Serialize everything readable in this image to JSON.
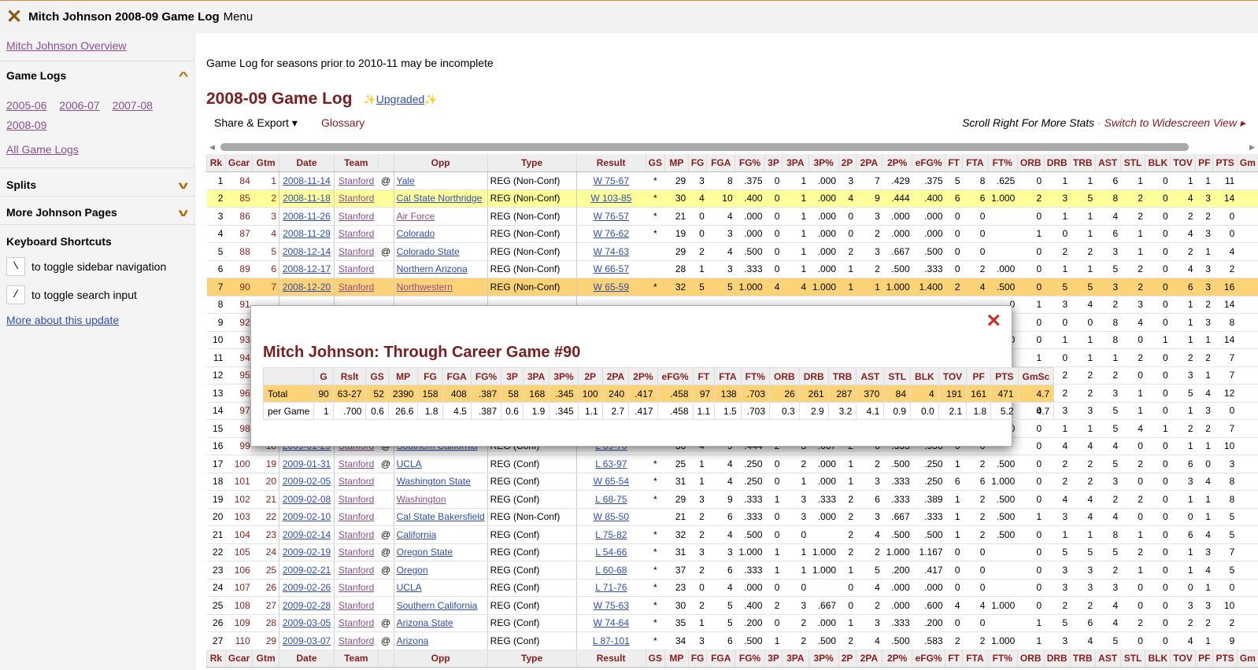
{
  "topbar": {
    "title": "Mitch Johnson 2008-09 Game Log",
    "menu": "Menu"
  },
  "sidebar": {
    "overview": "Mitch Johnson Overview",
    "game_logs_header": "Game Logs",
    "seasons": [
      "2005-06",
      "2006-07",
      "2007-08",
      "2008-09"
    ],
    "all_game_logs": "All Game Logs",
    "splits": "Splits",
    "more_pages": "More Johnson Pages",
    "keyboard_header": "Keyboard Shortcuts",
    "shortcuts": [
      {
        "key": "\\",
        "desc": "to toggle sidebar navigation"
      },
      {
        "key": "/",
        "desc": "to toggle search input"
      }
    ],
    "more_about": "More about this update"
  },
  "main": {
    "notice": "Game Log for seasons prior to 2010-11 may be incomplete",
    "heading": "2008-09 Game Log",
    "upgraded": "Upgraded",
    "share_export": "Share & Export ▾",
    "glossary": "Glossary",
    "scroll_hint": "Scroll Right For More Stats",
    "separator": "·",
    "widescreen": "Switch to Widescreen View ▸"
  },
  "table": {
    "columns": [
      "Rk",
      "Gcar",
      "Gtm",
      "Date",
      "Team",
      "",
      "Opp",
      "Type",
      "Result",
      "GS",
      "MP",
      "FG",
      "FGA",
      "FG%",
      "3P",
      "3PA",
      "3P%",
      "2P",
      "2PA",
      "2P%",
      "eFG%",
      "FT",
      "FTA",
      "FT%",
      "ORB",
      "DRB",
      "TRB",
      "AST",
      "STL",
      "BLK",
      "TOV",
      "PF",
      "PTS",
      "Gm"
    ],
    "rows": [
      [
        "1",
        "84",
        "1",
        "2008-11-14",
        "Stanford",
        "@",
        "Yale",
        "REG (Non-Conf)",
        "W 75-67",
        "*",
        "29",
        "3",
        "8",
        ".375",
        "0",
        "1",
        ".000",
        "3",
        "7",
        ".429",
        ".375",
        "5",
        "8",
        ".625",
        "0",
        "1",
        "1",
        "6",
        "1",
        "0",
        "1",
        "1",
        "11",
        ""
      ],
      [
        "2",
        "85",
        "2",
        "2008-11-18",
        "Stanford",
        "",
        "Cal State Northridge",
        "REG (Non-Conf)",
        "W 103-85",
        "*",
        "30",
        "4",
        "10",
        ".400",
        "0",
        "1",
        ".000",
        "4",
        "9",
        ".444",
        ".400",
        "6",
        "6",
        "1.000",
        "2",
        "3",
        "5",
        "8",
        "2",
        "0",
        "4",
        "3",
        "14",
        ""
      ],
      [
        "3",
        "86",
        "3",
        "2008-11-26",
        "Stanford",
        "",
        "Air Force",
        "REG (Non-Conf)",
        "W 76-57",
        "*",
        "21",
        "0",
        "4",
        ".000",
        "0",
        "1",
        ".000",
        "0",
        "3",
        ".000",
        ".000",
        "0",
        "0",
        "",
        "0",
        "1",
        "1",
        "4",
        "2",
        "0",
        "2",
        "2",
        "0",
        ""
      ],
      [
        "4",
        "87",
        "4",
        "2008-11-29",
        "Stanford",
        "",
        "Colorado",
        "REG (Non-Conf)",
        "W 76-62",
        "*",
        "19",
        "0",
        "3",
        ".000",
        "0",
        "1",
        ".000",
        "0",
        "2",
        ".000",
        ".000",
        "0",
        "0",
        "",
        "1",
        "0",
        "1",
        "6",
        "1",
        "0",
        "4",
        "3",
        "0",
        ""
      ],
      [
        "5",
        "88",
        "5",
        "2008-12-14",
        "Stanford",
        "@",
        "Colorado State",
        "REG (Non-Conf)",
        "W 74-63",
        "",
        "29",
        "2",
        "4",
        ".500",
        "0",
        "1",
        ".000",
        "2",
        "3",
        ".667",
        ".500",
        "0",
        "0",
        "",
        "0",
        "2",
        "2",
        "3",
        "1",
        "0",
        "2",
        "1",
        "4",
        ""
      ],
      [
        "6",
        "89",
        "6",
        "2008-12-17",
        "Stanford",
        "",
        "Northern Arizona",
        "REG (Non-Conf)",
        "W 66-57",
        "",
        "28",
        "1",
        "3",
        ".333",
        "0",
        "1",
        ".000",
        "1",
        "2",
        ".500",
        ".333",
        "0",
        "2",
        ".000",
        "0",
        "1",
        "1",
        "5",
        "2",
        "0",
        "4",
        "3",
        "2",
        ""
      ],
      [
        "7",
        "90",
        "7",
        "2008-12-20",
        "Stanford",
        "",
        "Northwestern",
        "REG (Non-Conf)",
        "W 65-59",
        "*",
        "32",
        "5",
        "5",
        "1.000",
        "4",
        "4",
        "1.000",
        "1",
        "1",
        "1.000",
        "1.400",
        "2",
        "4",
        ".500",
        "0",
        "5",
        "5",
        "3",
        "2",
        "0",
        "6",
        "3",
        "16",
        ""
      ],
      [
        "8",
        "91",
        "",
        "",
        "",
        "",
        "",
        "",
        "",
        "",
        "",
        "",
        "",
        "",
        "",
        "",
        "",
        "",
        "",
        "",
        "",
        "",
        "",
        "0",
        "1",
        "3",
        "4",
        "2",
        "3",
        "0",
        "1",
        "2",
        "14",
        ""
      ],
      [
        "9",
        "92",
        "",
        "",
        "",
        "",
        "",
        "",
        "",
        "",
        "",
        "",
        "",
        "",
        "",
        "",
        "",
        "",
        "",
        "",
        "",
        "",
        "",
        "",
        "0",
        "0",
        "0",
        "8",
        "4",
        "0",
        "1",
        "3",
        "8",
        ""
      ],
      [
        "10",
        "93",
        "",
        "",
        "",
        "",
        "",
        "",
        "",
        "",
        "",
        "",
        "",
        "",
        "",
        "",
        "",
        "",
        "",
        "",
        "",
        "",
        "",
        "0",
        "0",
        "1",
        "1",
        "8",
        "0",
        "1",
        "1",
        "1",
        "14",
        ""
      ],
      [
        "11",
        "94",
        "",
        "",
        "",
        "",
        "",
        "",
        "",
        "",
        "",
        "",
        "",
        "",
        "",
        "",
        "",
        "",
        "",
        "",
        "",
        "",
        "",
        "",
        "1",
        "0",
        "1",
        "1",
        "2",
        "0",
        "2",
        "2",
        "7",
        ""
      ],
      [
        "12",
        "95",
        "",
        "",
        "",
        "",
        "",
        "",
        "",
        "",
        "",
        "",
        "",
        "",
        "",
        "",
        "",
        "",
        "",
        "",
        "",
        "",
        "",
        "0",
        "0",
        "2",
        "2",
        "2",
        "0",
        "0",
        "3",
        "1",
        "7",
        ""
      ],
      [
        "13",
        "96",
        "",
        "",
        "",
        "",
        "",
        "",
        "",
        "",
        "",
        "",
        "",
        "",
        "",
        "",
        "",
        "",
        "",
        "",
        "",
        "",
        "",
        "0",
        "0",
        "2",
        "2",
        "3",
        "1",
        "0",
        "5",
        "4",
        "12",
        ""
      ],
      [
        "14",
        "97",
        "",
        "",
        "",
        "",
        "",
        "",
        "",
        "",
        "",
        "",
        "",
        "",
        "",
        "",
        "",
        "",
        "",
        "",
        "",
        "",
        "",
        "",
        "0",
        "3",
        "3",
        "5",
        "1",
        "0",
        "1",
        "3",
        "0",
        ""
      ],
      [
        "15",
        "98",
        "",
        "",
        "",
        "",
        "",
        "",
        "",
        "",
        "",
        "",
        "",
        "",
        "",
        "",
        "",
        "",
        "",
        "",
        "",
        "",
        "",
        "0",
        "0",
        "1",
        "1",
        "5",
        "4",
        "1",
        "2",
        "2",
        "7",
        ""
      ],
      [
        "16",
        "99",
        "18",
        "2009-01-29",
        "Stanford",
        "@",
        "Southern California",
        "REG (Conf)",
        "L 69-70",
        "*",
        "36",
        "4",
        "9",
        ".444",
        "2",
        "3",
        ".667",
        "2",
        "6",
        ".333",
        ".556",
        "0",
        "0",
        "",
        "0",
        "4",
        "4",
        "4",
        "0",
        "0",
        "1",
        "1",
        "10",
        ""
      ],
      [
        "17",
        "100",
        "19",
        "2009-01-31",
        "Stanford",
        "@",
        "UCLA",
        "REG (Conf)",
        "L 63-97",
        "*",
        "25",
        "1",
        "4",
        ".250",
        "0",
        "2",
        ".000",
        "1",
        "2",
        ".500",
        ".250",
        "1",
        "2",
        ".500",
        "0",
        "2",
        "2",
        "5",
        "2",
        "0",
        "6",
        "0",
        "3",
        ""
      ],
      [
        "18",
        "101",
        "20",
        "2009-02-05",
        "Stanford",
        "",
        "Washington State",
        "REG (Conf)",
        "W 65-54",
        "*",
        "31",
        "1",
        "4",
        ".250",
        "0",
        "1",
        ".000",
        "1",
        "3",
        ".333",
        ".250",
        "6",
        "6",
        "1.000",
        "0",
        "2",
        "2",
        "3",
        "0",
        "0",
        "3",
        "4",
        "8",
        ""
      ],
      [
        "19",
        "102",
        "21",
        "2009-02-08",
        "Stanford",
        "",
        "Washington",
        "REG (Conf)",
        "L 68-75",
        "*",
        "29",
        "3",
        "9",
        ".333",
        "1",
        "3",
        ".333",
        "2",
        "6",
        ".333",
        ".389",
        "1",
        "2",
        ".500",
        "0",
        "4",
        "4",
        "2",
        "2",
        "0",
        "1",
        "1",
        "8",
        ""
      ],
      [
        "20",
        "103",
        "22",
        "2009-02-10",
        "Stanford",
        "",
        "Cal State Bakersfield",
        "REG (Non-Conf)",
        "W 85-50",
        "",
        "21",
        "2",
        "6",
        ".333",
        "0",
        "3",
        ".000",
        "2",
        "3",
        ".667",
        ".333",
        "1",
        "2",
        ".500",
        "1",
        "3",
        "4",
        "4",
        "0",
        "0",
        "0",
        "1",
        "5",
        ""
      ],
      [
        "21",
        "104",
        "23",
        "2009-02-14",
        "Stanford",
        "@",
        "California",
        "REG (Conf)",
        "L 75-82",
        "*",
        "32",
        "2",
        "4",
        ".500",
        "0",
        "0",
        "",
        "2",
        "4",
        ".500",
        ".500",
        "1",
        "2",
        ".500",
        "0",
        "1",
        "1",
        "8",
        "1",
        "0",
        "6",
        "4",
        "5",
        ""
      ],
      [
        "22",
        "105",
        "24",
        "2009-02-19",
        "Stanford",
        "@",
        "Oregon State",
        "REG (Conf)",
        "L 54-66",
        "*",
        "31",
        "3",
        "3",
        "1.000",
        "1",
        "1",
        "1.000",
        "2",
        "2",
        "1.000",
        "1.167",
        "0",
        "0",
        "",
        "0",
        "5",
        "5",
        "5",
        "2",
        "0",
        "1",
        "3",
        "7",
        ""
      ],
      [
        "23",
        "106",
        "25",
        "2009-02-21",
        "Stanford",
        "@",
        "Oregon",
        "REG (Conf)",
        "L 60-68",
        "*",
        "37",
        "2",
        "6",
        ".333",
        "1",
        "1",
        "1.000",
        "1",
        "5",
        ".200",
        ".417",
        "0",
        "0",
        "",
        "0",
        "3",
        "3",
        "2",
        "1",
        "0",
        "1",
        "4",
        "5",
        ""
      ],
      [
        "24",
        "107",
        "26",
        "2009-02-26",
        "Stanford",
        "",
        "UCLA",
        "REG (Conf)",
        "L 71-76",
        "*",
        "23",
        "0",
        "4",
        ".000",
        "0",
        "0",
        "",
        "0",
        "4",
        ".000",
        ".000",
        "0",
        "0",
        "",
        "0",
        "3",
        "3",
        "3",
        "0",
        "0",
        "0",
        "1",
        "0",
        ""
      ],
      [
        "25",
        "108",
        "27",
        "2009-02-28",
        "Stanford",
        "",
        "Southern California",
        "REG (Conf)",
        "W 75-63",
        "*",
        "30",
        "2",
        "5",
        ".400",
        "2",
        "3",
        ".667",
        "0",
        "2",
        ".000",
        ".600",
        "4",
        "4",
        "1.000",
        "0",
        "2",
        "2",
        "4",
        "0",
        "0",
        "3",
        "3",
        "10",
        ""
      ],
      [
        "26",
        "109",
        "28",
        "2009-03-05",
        "Stanford",
        "@",
        "Arizona State",
        "REG (Conf)",
        "W 74-64",
        "*",
        "35",
        "1",
        "5",
        ".200",
        "0",
        "2",
        ".000",
        "1",
        "3",
        ".333",
        ".200",
        "0",
        "0",
        "",
        "1",
        "5",
        "6",
        "4",
        "2",
        "0",
        "2",
        "2",
        "2",
        ""
      ],
      [
        "27",
        "110",
        "29",
        "2009-03-07",
        "Stanford",
        "@",
        "Arizona",
        "REG (Conf)",
        "L 87-101",
        "*",
        "34",
        "3",
        "6",
        ".500",
        "1",
        "2",
        ".500",
        "2",
        "4",
        ".500",
        ".583",
        "2",
        "2",
        "1.000",
        "1",
        "3",
        "4",
        "5",
        "0",
        "0",
        "4",
        "1",
        "9",
        ""
      ]
    ]
  },
  "modal": {
    "title": "Mitch Johnson: Through Career Game #90",
    "close": "×",
    "columns": [
      "",
      "G",
      "Rslt",
      "GS",
      "MP",
      "FG",
      "FGA",
      "FG%",
      "3P",
      "3PA",
      "3P%",
      "2P",
      "2PA",
      "2P%",
      "eFG%",
      "FT",
      "FTA",
      "FT%",
      "ORB",
      "DRB",
      "TRB",
      "AST",
      "STL",
      "BLK",
      "TOV",
      "PF",
      "PTS",
      "GmSc"
    ],
    "rows": [
      [
        "Total",
        "90",
        "63-27",
        "52",
        "2390",
        "158",
        "408",
        ".387",
        "58",
        "168",
        ".345",
        "100",
        "240",
        ".417",
        ".458",
        "97",
        "138",
        ".703",
        "26",
        "261",
        "287",
        "370",
        "84",
        "4",
        "191",
        "161",
        "471",
        "4.7"
      ],
      [
        "per Game",
        "1",
        ".700",
        "0.6",
        "26.6",
        "1.8",
        "4.5",
        ".387",
        "0.6",
        "1.9",
        ".345",
        "1.1",
        "2.7",
        ".417",
        ".458",
        "1.1",
        "1.5",
        ".703",
        "0.3",
        "2.9",
        "3.2",
        "4.1",
        "0.9",
        "0.0",
        "2.1",
        "1.8",
        "5.2",
        "4.7"
      ]
    ]
  },
  "colors": {
    "accent": "#8b1c1c",
    "link": "#2f4eb3",
    "visited": "#8a4e8e",
    "highlight_yellow": "#ffff99",
    "highlight_orange": "#fdd377"
  }
}
